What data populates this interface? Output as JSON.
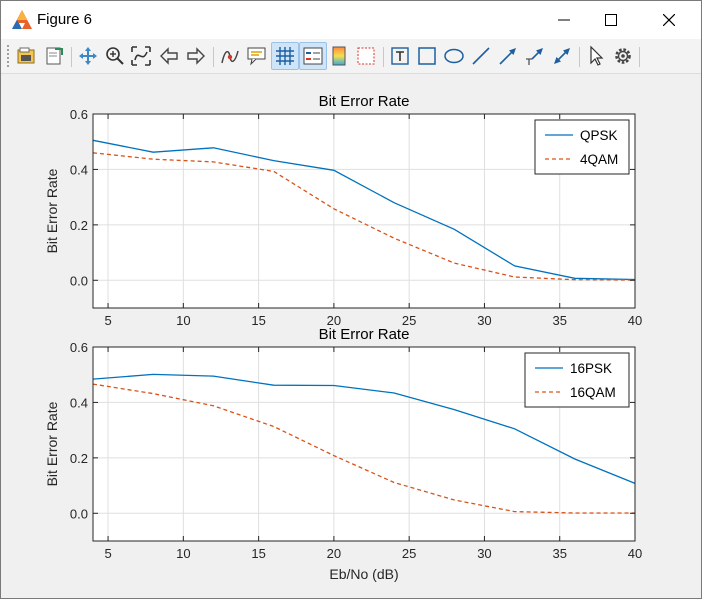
{
  "window": {
    "title": "Figure 6"
  },
  "toolbar": {
    "items": [
      {
        "name": "open-file-icon"
      },
      {
        "name": "save-figure-icon"
      },
      {
        "name": "pan-icon"
      },
      {
        "name": "zoom-in-icon"
      },
      {
        "name": "data-cursor-icon"
      },
      {
        "name": "back-arrow-icon"
      },
      {
        "name": "forward-arrow-icon"
      },
      {
        "name": "brush-icon"
      },
      {
        "name": "data-tips-icon"
      },
      {
        "name": "grid-icon",
        "active": true
      },
      {
        "name": "legend-icon",
        "active": true
      },
      {
        "name": "colorbar-icon"
      },
      {
        "name": "plot-box-icon"
      },
      {
        "name": "text-box-icon"
      },
      {
        "name": "rectangle-icon"
      },
      {
        "name": "ellipse-icon"
      },
      {
        "name": "line-icon"
      },
      {
        "name": "arrow-icon"
      },
      {
        "name": "text-arrow-icon"
      },
      {
        "name": "double-arrow-icon"
      },
      {
        "name": "select-pointer-icon"
      },
      {
        "name": "settings-gear-icon"
      }
    ]
  },
  "colors": {
    "series1": "#0072bd",
    "series2": "#d95319",
    "axes_bg": "#ffffff",
    "figure_bg": "#f0f0f0"
  },
  "chart_data": [
    {
      "type": "line",
      "title": "Bit Error Rate",
      "xlabel": "",
      "ylabel": "Bit Error Rate",
      "xlim": [
        4,
        40
      ],
      "ylim": [
        -0.1,
        0.6
      ],
      "xticks": [
        5,
        10,
        15,
        20,
        25,
        30,
        35,
        40
      ],
      "yticks": [
        0.0,
        0.2,
        0.4,
        0.6
      ],
      "grid": true,
      "legend": "top-right",
      "x": [
        4,
        8,
        12,
        16,
        20,
        24,
        28,
        32,
        36,
        40
      ],
      "series": [
        {
          "name": "QPSK",
          "style": "solid",
          "values": [
            0.505,
            0.462,
            0.478,
            0.432,
            0.397,
            0.28,
            0.184,
            0.052,
            0.007,
            0.003
          ]
        },
        {
          "name": "4QAM",
          "style": "dashed",
          "values": [
            0.46,
            0.437,
            0.427,
            0.393,
            0.258,
            0.152,
            0.062,
            0.012,
            0.002,
            0.001
          ]
        }
      ]
    },
    {
      "type": "line",
      "title": "Bit Error Rate",
      "xlabel": "Eb/No (dB)",
      "ylabel": "Bit Error Rate",
      "xlim": [
        4,
        40
      ],
      "ylim": [
        -0.1,
        0.6
      ],
      "xticks": [
        5,
        10,
        15,
        20,
        25,
        30,
        35,
        40
      ],
      "yticks": [
        0.0,
        0.2,
        0.4,
        0.6
      ],
      "grid": true,
      "legend": "top-right",
      "x": [
        4,
        8,
        12,
        16,
        20,
        24,
        28,
        32,
        36,
        40
      ],
      "series": [
        {
          "name": "16PSK",
          "style": "solid",
          "values": [
            0.484,
            0.501,
            0.495,
            0.462,
            0.461,
            0.434,
            0.374,
            0.305,
            0.196,
            0.108
          ]
        },
        {
          "name": "16QAM",
          "style": "dashed",
          "values": [
            0.466,
            0.432,
            0.388,
            0.313,
            0.208,
            0.111,
            0.048,
            0.006,
            0.001,
            0.001
          ]
        }
      ]
    }
  ]
}
